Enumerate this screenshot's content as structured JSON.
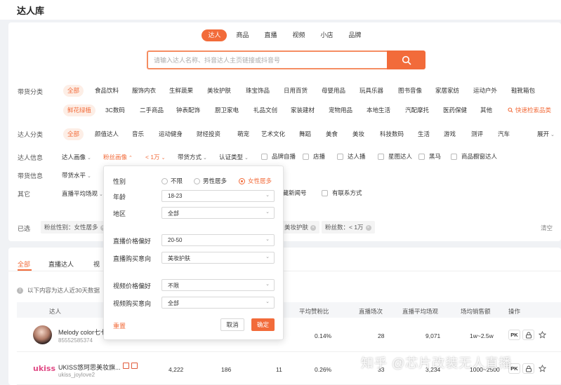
{
  "page": {
    "title": "达人库"
  },
  "search": {
    "tabs": [
      "达人",
      "商品",
      "直播",
      "视频",
      "小店",
      "品牌"
    ],
    "placeholder": "请输入达人名称、抖音达人主页链接或抖音号"
  },
  "filters": {
    "goods_category_label": "带货分类",
    "goods_categories_row1": [
      "全部",
      "食品饮料",
      "服饰内衣",
      "生鲜蔬果",
      "美妆护肤",
      "珠宝饰品",
      "日用百货",
      "母婴用品",
      "玩具乐器",
      "图书音像",
      "家居家纺",
      "运动户外",
      "鞋靴箱包"
    ],
    "goods_categories_row2": [
      "鲜花绿植",
      "3C数码",
      "二手商品",
      "钟表配饰",
      "厨卫家电",
      "礼品文创",
      "家装建材",
      "宠物用品",
      "本地生活",
      "汽配摩托",
      "医药保健",
      "其他"
    ],
    "quick_search": "快速检索品类",
    "talent_category_label": "达人分类",
    "talent_categories": [
      "全部",
      "颜值达人",
      "音乐",
      "运动健身",
      "财经投资",
      "萌宠",
      "艺术文化",
      "舞蹈",
      "美食",
      "美妆",
      "科技数码",
      "生活",
      "游戏",
      "测评",
      "汽车"
    ],
    "expand": "展开",
    "talent_info_label": "达人信息",
    "talent_info_dropdowns": [
      "达人画像",
      "粉丝画像",
      "< 1万",
      "带货方式",
      "认证类型"
    ],
    "talent_info_checks": [
      "品牌自播",
      "店播",
      "达人播",
      "星图达人",
      "黑马",
      "商品橱窗达人"
    ],
    "goods_info_label": "带货信息",
    "goods_info_dropdowns": [
      "带货水平"
    ],
    "other_label": "其它",
    "other_dropdowns": [
      "直播平均场观"
    ],
    "other_checks": [
      "隐藏新闻号",
      "有联系方式"
    ],
    "selected_label": "已选",
    "selected_tags": [
      "粉丝性别：女性居多",
      "美妆护肤",
      "粉丝数：< 1万"
    ],
    "clear": "清空"
  },
  "popover": {
    "gender_label": "性别",
    "gender_options": [
      "不限",
      "男性居多",
      "女性居多"
    ],
    "gender_selected": "女性居多",
    "age_label": "年龄",
    "age_value": "18-23",
    "region_label": "地区",
    "region_value": "全部",
    "live_price_label": "直播价格偏好",
    "live_price_value": "20-50",
    "live_intent_label": "直播购买意向",
    "live_intent_value": "美妆护肤",
    "video_price_label": "视频价格偏好",
    "video_price_value": "不限",
    "video_intent_label": "视频购买意向",
    "video_intent_value": "全部",
    "reset": "重置",
    "cancel": "取消",
    "confirm": "确定"
  },
  "results": {
    "tabs": [
      "全部",
      "直播达人",
      "视"
    ],
    "info": "以下内容为达人近30天数据",
    "columns": [
      "达人",
      "平均赞粉比",
      "直播场次",
      "直播平均场观",
      "场均销售额",
      "操作"
    ],
    "rows": [
      {
        "name": "Melody color七七彩",
        "id": "85552585374",
        "col1": "",
        "col2": "",
        "col3": "",
        "avg_like_ratio": "0.14%",
        "live_count": "28",
        "live_avg_views": "9,071",
        "avg_sales": "1w~2.5w"
      },
      {
        "name": "UKISS悠珂思美妆旗...",
        "id": "ukiss_joylove2",
        "col1": "4,222",
        "col2": "186",
        "col3": "11",
        "avg_like_ratio": "0.26%",
        "live_count": "33",
        "live_avg_views": "3,234",
        "avg_sales": "1000~2500"
      }
    ],
    "row2_logo": "ukiss",
    "pk_label": "PK"
  },
  "watermark": "知乎 @芯片改装无人直播",
  "colors": {
    "accent": "#f26b3a",
    "accent_bg": "#fdeee6",
    "page_bg": "#f0f2f5"
  }
}
